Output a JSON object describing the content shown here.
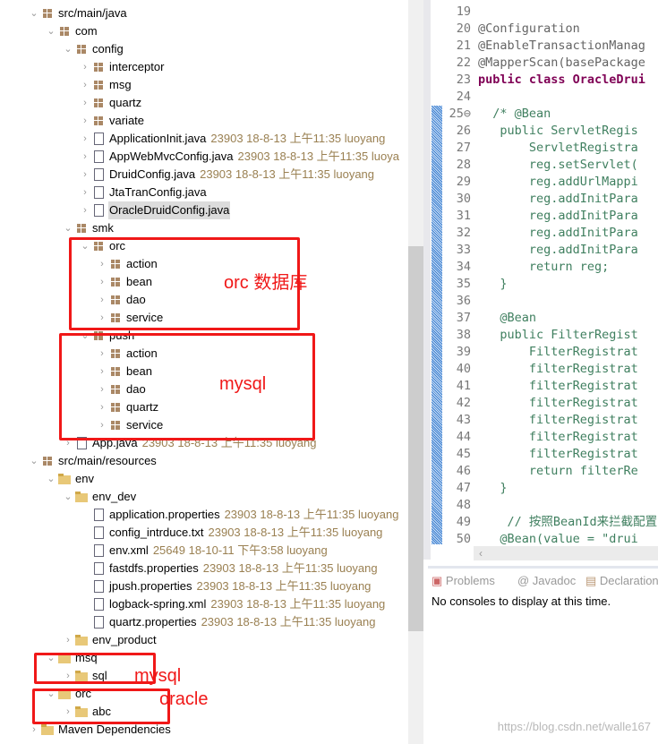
{
  "tree": [
    {
      "label": "src/main/java",
      "level": 0,
      "open": true,
      "icon": "source-folder-icon"
    },
    {
      "label": "com",
      "level": 1,
      "open": true,
      "icon": "package-icon"
    },
    {
      "label": "config",
      "level": 2,
      "open": true,
      "icon": "package-icon"
    },
    {
      "label": "interceptor",
      "level": 3,
      "open": false,
      "icon": "package-icon"
    },
    {
      "label": "msg",
      "level": 3,
      "open": false,
      "icon": "package-icon"
    },
    {
      "label": "quartz",
      "level": 3,
      "open": false,
      "icon": "package-icon"
    },
    {
      "label": "variate",
      "level": 3,
      "open": false,
      "icon": "package-icon"
    },
    {
      "label": "ApplicationInit.java",
      "level": 3,
      "open": false,
      "icon": "java-file-icon",
      "decoration": "23903  18-8-13 上午11:35  luoyang"
    },
    {
      "label": "AppWebMvcConfig.java",
      "level": 3,
      "open": false,
      "icon": "java-file-icon",
      "decoration": "23903  18-8-13 上午11:35  luoya"
    },
    {
      "label": "DruidConfig.java",
      "level": 3,
      "open": false,
      "icon": "java-file-icon",
      "decoration": "23903  18-8-13 上午11:35  luoyang"
    },
    {
      "label": "JtaTranConfig.java",
      "level": 3,
      "open": false,
      "icon": "java-file-icon"
    },
    {
      "label": "OracleDruidConfig.java",
      "level": 3,
      "open": false,
      "icon": "java-file-icon",
      "selected": true
    },
    {
      "label": "smk",
      "level": 2,
      "open": true,
      "icon": "package-icon"
    },
    {
      "label": "orc",
      "level": 3,
      "open": true,
      "icon": "package-icon"
    },
    {
      "label": "action",
      "level": 4,
      "open": false,
      "icon": "package-icon"
    },
    {
      "label": "bean",
      "level": 4,
      "open": false,
      "icon": "package-icon"
    },
    {
      "label": "dao",
      "level": 4,
      "open": false,
      "icon": "package-icon"
    },
    {
      "label": "service",
      "level": 4,
      "open": false,
      "icon": "package-icon"
    },
    {
      "label": "push",
      "level": 3,
      "open": true,
      "icon": "package-icon"
    },
    {
      "label": "action",
      "level": 4,
      "open": false,
      "icon": "package-icon"
    },
    {
      "label": "bean",
      "level": 4,
      "open": false,
      "icon": "package-icon"
    },
    {
      "label": "dao",
      "level": 4,
      "open": false,
      "icon": "package-icon"
    },
    {
      "label": "quartz",
      "level": 4,
      "open": false,
      "icon": "package-icon"
    },
    {
      "label": "service",
      "level": 4,
      "open": false,
      "icon": "package-icon"
    },
    {
      "label": "App.java",
      "level": 2,
      "open": false,
      "icon": "java-file-icon",
      "decoration": "23903  18-8-13 上午11:35  luoyang"
    },
    {
      "label": "src/main/resources",
      "level": 0,
      "open": true,
      "icon": "source-folder-icon"
    },
    {
      "label": "env",
      "level": 1,
      "open": true,
      "icon": "folder-icon"
    },
    {
      "label": "env_dev",
      "level": 2,
      "open": true,
      "icon": "folder-icon"
    },
    {
      "label": "application.properties",
      "level": 3,
      "leaf": true,
      "icon": "properties-file-icon",
      "decoration": "23903  18-8-13 上午11:35  luoyang"
    },
    {
      "label": "config_intrduce.txt",
      "level": 3,
      "leaf": true,
      "icon": "text-file-icon",
      "decoration": "23903  18-8-13 上午11:35  luoyang"
    },
    {
      "label": "env.xml",
      "level": 3,
      "leaf": true,
      "icon": "xml-file-icon",
      "decoration": "25649  18-10-11 下午3:58  luoyang"
    },
    {
      "label": "fastdfs.properties",
      "level": 3,
      "leaf": true,
      "icon": "properties-file-icon",
      "decoration": "23903  18-8-13 上午11:35  luoyang"
    },
    {
      "label": "jpush.properties",
      "level": 3,
      "leaf": true,
      "icon": "properties-file-icon",
      "decoration": "23903  18-8-13 上午11:35  luoyang"
    },
    {
      "label": "logback-spring.xml",
      "level": 3,
      "leaf": true,
      "icon": "xml-file-icon",
      "decoration": "23903  18-8-13 上午11:35  luoyang"
    },
    {
      "label": "quartz.properties",
      "level": 3,
      "leaf": true,
      "icon": "properties-file-icon",
      "decoration": "23903  18-8-13 上午11:35  luoyang"
    },
    {
      "label": "env_product",
      "level": 2,
      "open": false,
      "icon": "folder-icon"
    },
    {
      "label": "msq",
      "level": 1,
      "open": true,
      "icon": "folder-icon"
    },
    {
      "label": "sql",
      "level": 2,
      "open": false,
      "icon": "folder-icon"
    },
    {
      "label": "orc",
      "level": 1,
      "open": true,
      "icon": "folder-icon"
    },
    {
      "label": "abc",
      "level": 2,
      "open": false,
      "icon": "folder-icon"
    },
    {
      "label": "Maven Dependencies",
      "level": 0,
      "open": false,
      "icon": "library-icon"
    }
  ],
  "code": [
    {
      "n": "19",
      "t": "",
      "c": "pl"
    },
    {
      "n": "20",
      "t": "@Configuration",
      "c": "ann"
    },
    {
      "n": "21",
      "t": "@EnableTransactionManag",
      "c": "ann"
    },
    {
      "n": "22",
      "t": "@MapperScan(basePackage",
      "c": "ann"
    },
    {
      "n": "23",
      "t": "public class OracleDrui",
      "c": "kw"
    },
    {
      "n": "24",
      "t": "",
      "c": "pl"
    },
    {
      "n": "25⊖",
      "t": "  /* @Bean",
      "c": "cm"
    },
    {
      "n": "26",
      "t": "   public ServletRegis",
      "c": "cm"
    },
    {
      "n": "27",
      "t": "       ServletRegistra",
      "c": "cm"
    },
    {
      "n": "28",
      "t": "       reg.setServlet(",
      "c": "cm"
    },
    {
      "n": "29",
      "t": "       reg.addUrlMappi",
      "c": "cm"
    },
    {
      "n": "30",
      "t": "       reg.addInitPara",
      "c": "cm"
    },
    {
      "n": "31",
      "t": "       reg.addInitPara",
      "c": "cm"
    },
    {
      "n": "32",
      "t": "       reg.addInitPara",
      "c": "cm"
    },
    {
      "n": "33",
      "t": "       reg.addInitPara",
      "c": "cm"
    },
    {
      "n": "34",
      "t": "       return reg;",
      "c": "cm"
    },
    {
      "n": "35",
      "t": "   }",
      "c": "cm"
    },
    {
      "n": "36",
      "t": "",
      "c": "cm"
    },
    {
      "n": "37",
      "t": "   @Bean",
      "c": "cm"
    },
    {
      "n": "38",
      "t": "   public FilterRegist",
      "c": "cm"
    },
    {
      "n": "39",
      "t": "       FilterRegistrat",
      "c": "cm"
    },
    {
      "n": "40",
      "t": "       filterRegistrat",
      "c": "cm"
    },
    {
      "n": "41",
      "t": "       filterRegistrat",
      "c": "cm"
    },
    {
      "n": "42",
      "t": "       filterRegistrat",
      "c": "cm"
    },
    {
      "n": "43",
      "t": "       filterRegistrat",
      "c": "cm"
    },
    {
      "n": "44",
      "t": "       filterRegistrat",
      "c": "cm"
    },
    {
      "n": "45",
      "t": "       filterRegistrat",
      "c": "cm"
    },
    {
      "n": "46",
      "t": "       return filterRe",
      "c": "cm"
    },
    {
      "n": "47",
      "t": "   }",
      "c": "cm"
    },
    {
      "n": "48",
      "t": "",
      "c": "cm"
    },
    {
      "n": "49",
      "t": "    // 按照BeanId来拦截配置",
      "c": "cm"
    },
    {
      "n": "50",
      "t": "   @Bean(value = \"drui",
      "c": "cm"
    }
  ],
  "panel": {
    "tabs": [
      "Problems",
      "@ Javadoc",
      "Declaration"
    ],
    "console": "No consoles to display at this time."
  },
  "annotations": {
    "box1": "orc 数据库",
    "box2": "mysql",
    "box3": "mysql",
    "box4": "oracle",
    "color": "#f01818"
  },
  "watermark": "https://blog.csdn.net/walle167"
}
